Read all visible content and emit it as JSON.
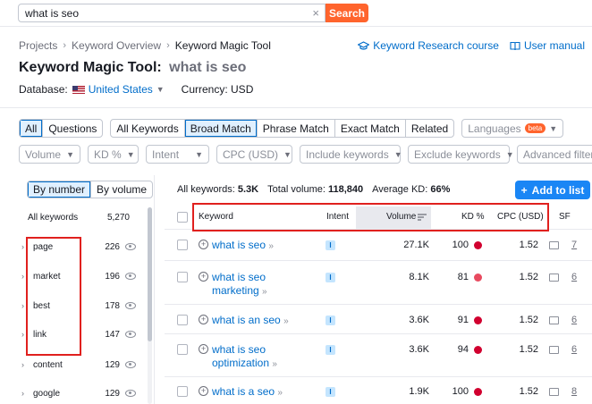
{
  "search": {
    "query": "what is seo",
    "button": "Search",
    "clear": "×"
  },
  "breadcrumb": [
    "Projects",
    "Keyword Overview",
    "Keyword Magic Tool"
  ],
  "breadcrumb_sep": "›",
  "head_links": {
    "course": "Keyword Research course",
    "manual": "User manual"
  },
  "title": {
    "tool": "Keyword Magic Tool:",
    "query": "what is seo"
  },
  "database": {
    "label": "Database:",
    "value": "United States",
    "currency": "Currency: USD"
  },
  "match_tabs": {
    "group1": [
      "All",
      "Questions"
    ],
    "group2": [
      "All Keywords",
      "Broad Match",
      "Phrase Match",
      "Exact Match",
      "Related"
    ],
    "active1": "All",
    "active2": "Broad Match"
  },
  "languages": {
    "label": "Languages",
    "badge": "beta"
  },
  "filters": [
    "Volume",
    "KD %",
    "Intent",
    "CPC (USD)",
    "Include keywords",
    "Exclude keywords",
    "Advanced filters"
  ],
  "left": {
    "toggle": [
      "By number",
      "By volume"
    ],
    "all_keywords_label": "All keywords",
    "all_keywords_count": "5,270",
    "groups": [
      {
        "name": "page",
        "count": "226"
      },
      {
        "name": "market",
        "count": "196"
      },
      {
        "name": "best",
        "count": "178"
      },
      {
        "name": "link",
        "count": "147"
      },
      {
        "name": "content",
        "count": "129"
      },
      {
        "name": "google",
        "count": "129"
      }
    ]
  },
  "summary": {
    "all_label": "All keywords:",
    "all_value": "5.3K",
    "vol_label": "Total volume:",
    "vol_value": "118,840",
    "kd_label": "Average KD:",
    "kd_value": "66%"
  },
  "add_button": "Add to list",
  "columns": {
    "keyword": "Keyword",
    "intent": "Intent",
    "volume": "Volume",
    "kd": "KD %",
    "cpc": "CPC (USD)",
    "sf": "SF"
  },
  "rows": [
    {
      "keyword": "what is seo",
      "intent": "I",
      "volume": "27.1K",
      "kd": "100",
      "kd_color": "#d1002f",
      "cpc": "1.52",
      "sf": "7"
    },
    {
      "keyword": "what is seo marketing",
      "intent": "I",
      "volume": "8.1K",
      "kd": "81",
      "kd_color": "#e84a5f",
      "cpc": "1.52",
      "sf": "6"
    },
    {
      "keyword": "what is an seo",
      "intent": "I",
      "volume": "3.6K",
      "kd": "91",
      "kd_color": "#d1002f",
      "cpc": "1.52",
      "sf": "6"
    },
    {
      "keyword": "what is seo optimization",
      "intent": "I",
      "volume": "3.6K",
      "kd": "94",
      "kd_color": "#d1002f",
      "cpc": "1.52",
      "sf": "6"
    },
    {
      "keyword": "what is a seo",
      "intent": "I",
      "volume": "1.9K",
      "kd": "100",
      "kd_color": "#d1002f",
      "cpc": "1.52",
      "sf": "8"
    }
  ],
  "colors": {
    "accent": "#ff642d",
    "link": "#006dca",
    "highlight": "#e0201e"
  }
}
